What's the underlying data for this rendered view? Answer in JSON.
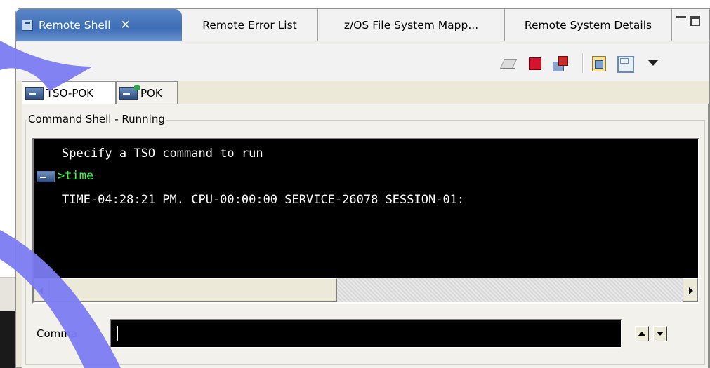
{
  "view_tabs": [
    {
      "label": "Remote Shell",
      "active": true
    },
    {
      "label": "Remote Error List"
    },
    {
      "label": "z/OS File System Mapp..."
    },
    {
      "label": "Remote System Details"
    }
  ],
  "toolbar": {
    "icons": [
      "clear-icon",
      "terminate-icon",
      "remove-shell-icon",
      "export-icon",
      "save-icon",
      "view-menu-icon"
    ]
  },
  "shell_tabs": [
    {
      "label": "TSO-POK",
      "active": true
    },
    {
      "label": "POK"
    }
  ],
  "group_label": "Command Shell - Running",
  "console": {
    "lines": [
      "Specify a TSO command to run",
      ">time",
      "TIME-04:28:21 PM. CPU-00:00:00 SERVICE-26078 SESSION-01:"
    ]
  },
  "command": {
    "label": "Comma",
    "value": ""
  },
  "colors": {
    "active_tab": "#3d6db5",
    "console_bg": "#000000",
    "prompt_green": "#33ff33",
    "overlay_arrow": "#7b7bf2"
  }
}
